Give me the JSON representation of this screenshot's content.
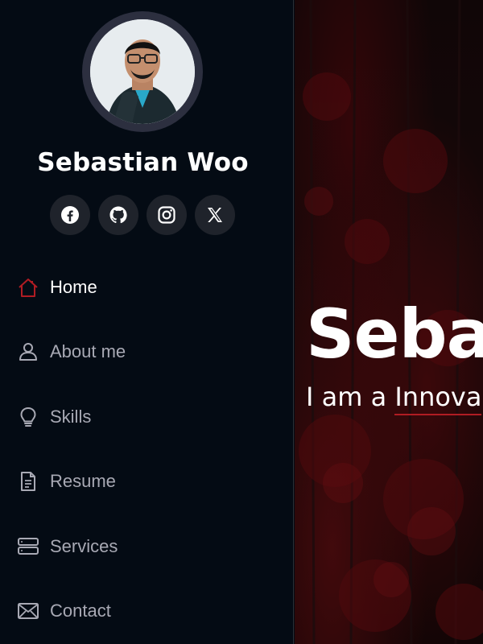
{
  "profile": {
    "name": "Sebastian Woo"
  },
  "social": [
    {
      "icon": "facebook-icon"
    },
    {
      "icon": "github-icon"
    },
    {
      "icon": "instagram-icon"
    },
    {
      "icon": "x-twitter-icon"
    }
  ],
  "nav": {
    "items": [
      {
        "label": "Home",
        "icon": "house-icon",
        "active": true
      },
      {
        "label": "About me",
        "icon": "person-icon",
        "active": false
      },
      {
        "label": "Skills",
        "icon": "lightbulb-icon",
        "active": false
      },
      {
        "label": "Resume",
        "icon": "document-icon",
        "active": false
      },
      {
        "label": "Services",
        "icon": "server-icon",
        "active": false
      },
      {
        "label": "Contact",
        "icon": "envelope-icon",
        "active": false
      }
    ]
  },
  "hero": {
    "title": "Sebas",
    "subtitle_prefix": "I am a ",
    "typed_text": "Innova"
  },
  "colors": {
    "accent": "#b01c23",
    "sidebar_bg": "#040b14",
    "nav_text": "#a8a9b4",
    "active_text": "#ffffff"
  }
}
